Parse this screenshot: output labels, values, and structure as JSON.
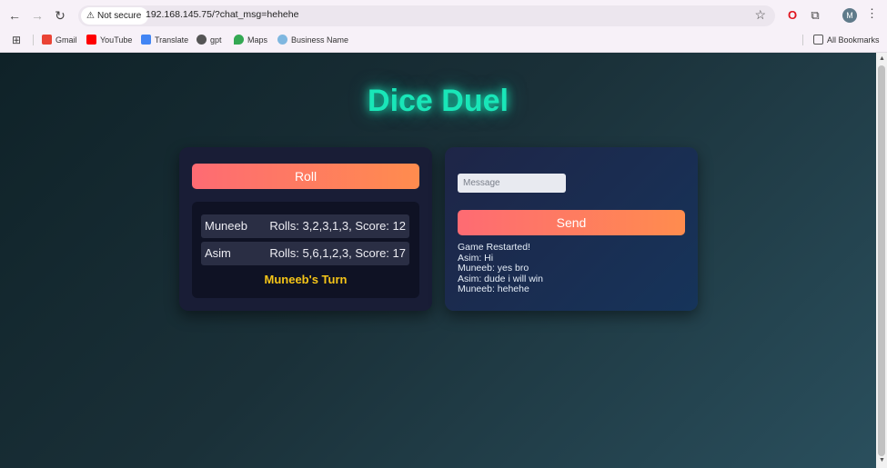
{
  "browser": {
    "security_label": "Not secure",
    "url": "192.168.145.75/?chat_msg=hehehe",
    "profile_initial": "M",
    "bookmarks": [
      "Gmail",
      "YouTube",
      "Translate",
      "gpt",
      "Maps",
      "Business Name"
    ],
    "all_bookmarks": "All Bookmarks"
  },
  "game": {
    "title": "Dice Duel",
    "roll_label": "Roll",
    "players": [
      {
        "name": "Muneeb",
        "stats": "Rolls: 3,2,3,1,3, Score: 12"
      },
      {
        "name": "Asim",
        "stats": "Rolls: 5,6,1,2,3, Score: 17"
      }
    ],
    "turn_text": "Muneeb's Turn"
  },
  "chat": {
    "placeholder": "Message",
    "send_label": "Send",
    "messages": [
      "Game Restarted!",
      "Asim: Hi",
      "Muneeb: yes bro",
      "Asim: dude i will win",
      "Muneeb: hehehe"
    ]
  },
  "colors": {
    "title_glow": "#19e6b8",
    "button_gradient_start": "#fe6b73",
    "button_gradient_end": "#ff8c4e",
    "turn_text": "#f5c518"
  }
}
